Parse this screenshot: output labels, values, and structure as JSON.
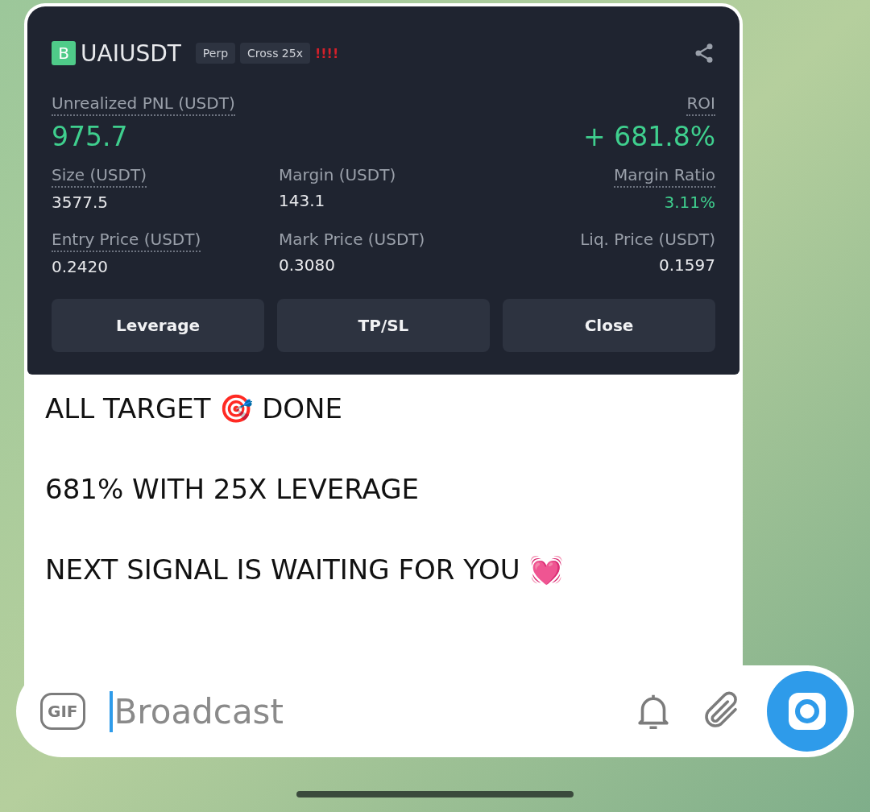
{
  "position_card": {
    "badge": "B",
    "symbol": "UAIUSDT",
    "tags": [
      "Perp",
      "Cross 25x"
    ],
    "alert": "!!!!",
    "pnl": {
      "label": "Unrealized PNL (USDT)",
      "value": "975.7",
      "dotted": true
    },
    "roi": {
      "label": "ROI",
      "value": "+ 681.8%",
      "dotted": true
    },
    "stats": [
      {
        "label": "Size (USDT)",
        "value": "3577.5",
        "dotted": true,
        "highlight": false
      },
      {
        "label": "Margin (USDT)",
        "value": "143.1",
        "dotted": false,
        "highlight": false
      },
      {
        "label": "Margin Ratio",
        "value": "3.11%",
        "dotted": true,
        "highlight": true
      },
      {
        "label": "Entry Price (USDT)",
        "value": "0.2420",
        "dotted": true,
        "highlight": false
      },
      {
        "label": "Mark Price (USDT)",
        "value": "0.3080",
        "dotted": false,
        "highlight": false
      },
      {
        "label": "Liq. Price (USDT)",
        "value": "0.1597",
        "dotted": false,
        "highlight": false
      }
    ],
    "buttons": [
      "Leverage",
      "TP/SL",
      "Close"
    ]
  },
  "message_lines": [
    "ALL TARGET 🎯 DONE",
    "681% WITH 25X LEVERAGE",
    "NEXT SIGNAL IS WAITING FOR YOU 💓"
  ],
  "composer": {
    "gif_label": "GIF",
    "placeholder": "Broadcast"
  }
}
